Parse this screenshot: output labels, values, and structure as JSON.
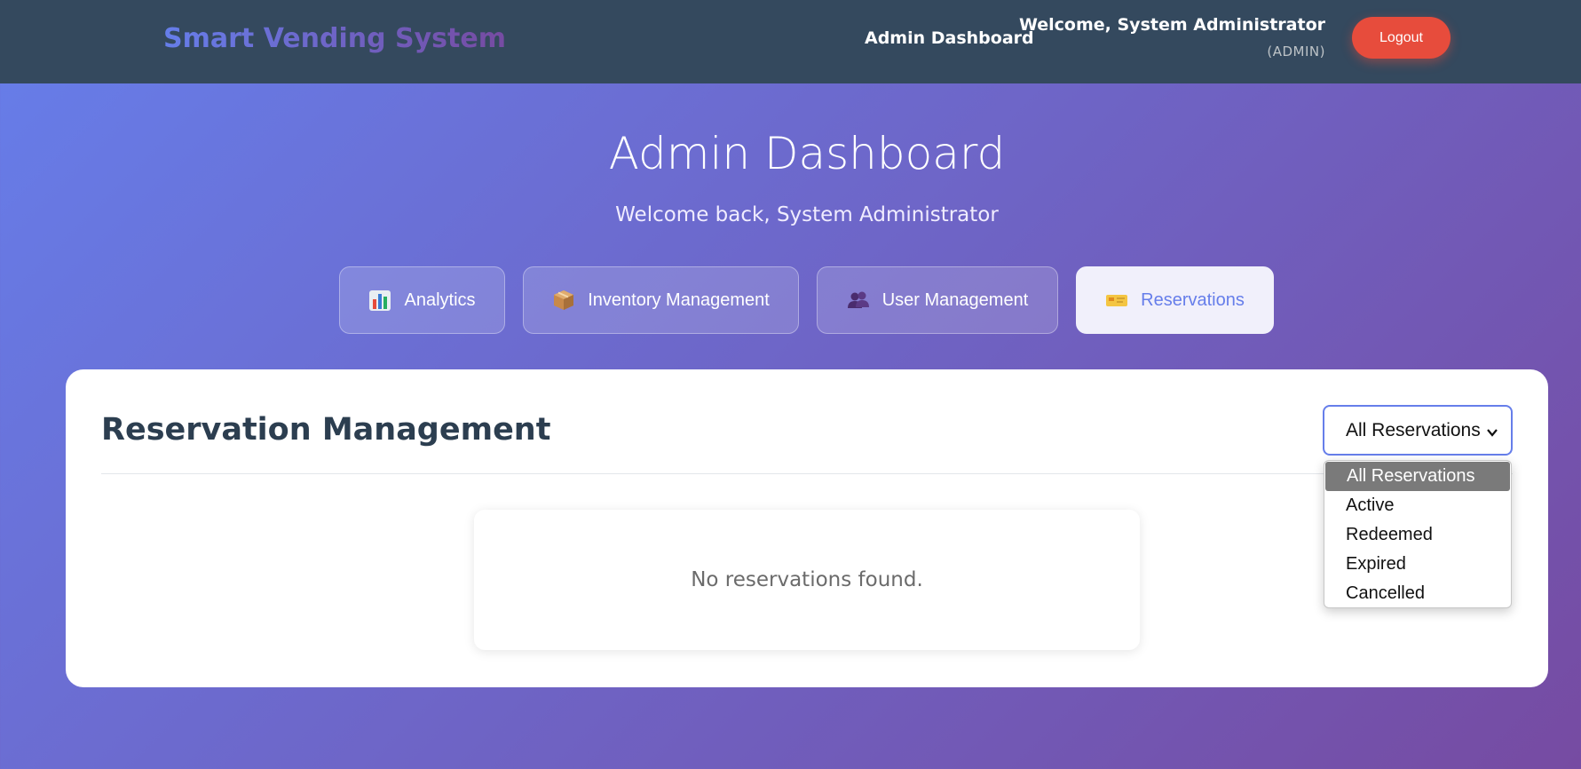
{
  "header": {
    "brand": "Smart Vending System",
    "nav_link": "Admin Dashboard",
    "user_name": "Welcome, System Administrator",
    "user_role": "(ADMIN)",
    "logout_label": "Logout"
  },
  "hero": {
    "title": "Admin Dashboard",
    "subtitle": "Welcome back, System Administrator"
  },
  "tabs": [
    {
      "label": "Analytics",
      "icon": "bar-chart-icon"
    },
    {
      "label": "Inventory Management",
      "icon": "package-icon"
    },
    {
      "label": "User Management",
      "icon": "users-icon"
    },
    {
      "label": "Reservations",
      "icon": "ticket-icon",
      "active": true
    }
  ],
  "panel": {
    "title": "Reservation Management",
    "empty_message": "No reservations found."
  },
  "filter": {
    "selected": "All Reservations",
    "options": [
      "All Reservations",
      "Active",
      "Redeemed",
      "Expired",
      "Cancelled"
    ]
  },
  "colors": {
    "accent": "#667eea",
    "topbar": "#34495e",
    "logout": "#e74c3c"
  }
}
